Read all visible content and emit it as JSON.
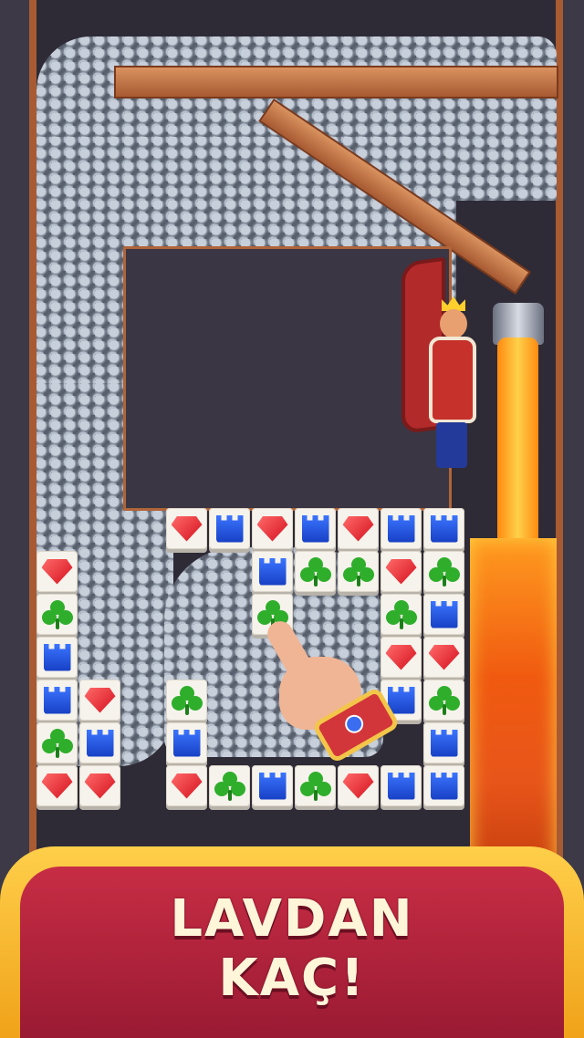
{
  "banner": {
    "line1": "LAVDAN",
    "line2": "KAÇ!"
  },
  "colors": {
    "banner_gold": "#f0a21a",
    "banner_red": "#c72d44",
    "lava": "#f05a10",
    "stone": "#8d95a3",
    "wood": "#a85a32"
  },
  "board": {
    "tile_types": [
      "gem",
      "rook",
      "clover"
    ],
    "icons": {
      "gem": "red-gem-icon",
      "rook": "blue-tower-icon",
      "clover": "green-clover-icon"
    }
  }
}
